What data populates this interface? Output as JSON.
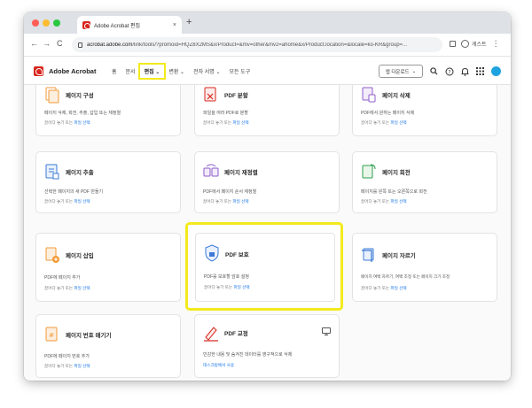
{
  "browser": {
    "tab_title": "Adobe Acrobat 편집",
    "tab_close": "×",
    "new_tab": "+",
    "back": "←",
    "forward": "→",
    "reload": "C",
    "url_host": "acrobat.adobe.com",
    "url_path": "/link/tools/?promoid=HQZ8X2MS&x/Product=&mv=other&mv2=ahome&x/Product.location=&locale=ko-KR&group=...",
    "profile_label": "게스트",
    "menu": "⋮"
  },
  "app": {
    "brand": "Adobe Acrobat",
    "nav": [
      "홈",
      "문서",
      "편집 ⌄",
      "변환 ⌄",
      "전자 서명 ⌄",
      "모든 도구"
    ],
    "install_label": "앱 다운로드",
    "install_chevron": "⌄",
    "icons": [
      "search-icon",
      "help-icon",
      "bell-icon",
      "apps-grid-icon"
    ],
    "accent": "#d7261e",
    "highlight": "#f3ea1c",
    "link_color": "#1473e6"
  },
  "cards": [
    {
      "title": "페이지 구성",
      "desc": "페이지 삭제, 회전, 추출, 삽입 또는 재정렬",
      "action_prefix": "끌어다 놓기 또는 ",
      "action_link": "파일 선택",
      "icon": "organize-pages-icon"
    },
    {
      "title": "PDF 분할",
      "desc": "파일을 여러 PDF로 분할",
      "action_prefix": "끌어다 놓기 또는 ",
      "action_link": "파일 선택",
      "icon": "split-pdf-icon"
    },
    {
      "title": "페이지 삭제",
      "desc": "PDF에서 원하는 페이지 삭제",
      "action_prefix": "끌어다 놓기 또는 ",
      "action_link": "파일 선택",
      "icon": "delete-pages-icon"
    },
    {
      "title": "페이지 추출",
      "desc": "선택한 페이지의 새 PDF 만들기",
      "action_prefix": "끌어다 놓기 또는 ",
      "action_link": "파일 선택",
      "icon": "extract-pages-icon"
    },
    {
      "title": "페이지 재정렬",
      "desc": "PDF에서 페이지 순서 재정렬",
      "action_prefix": "끌어다 놓기 또는 ",
      "action_link": "파일 선택",
      "icon": "reorder-pages-icon"
    },
    {
      "title": "페이지 회전",
      "desc": "페이지를 왼쪽 또는 오른쪽으로 회전",
      "action_prefix": "끌어다 놓기 또는 ",
      "action_link": "파일 선택",
      "icon": "rotate-pages-icon"
    },
    {
      "title": "페이지 삽입",
      "desc": "PDF에 페이지 추가",
      "action_prefix": "끌어다 놓기 또는 ",
      "action_link": "파일 선택",
      "icon": "insert-pages-icon"
    },
    {
      "title": "PDF 보호",
      "desc": "PDF를 보호할 암호 설정",
      "action_prefix": "끌어다 놓기 또는 ",
      "action_link": "파일 선택",
      "icon": "protect-pdf-icon"
    },
    {
      "title": "페이지 자르기",
      "desc": "페이지 여백 자르기, 여백 조정 또는 페이지 크기 조정",
      "action_prefix": "끌어다 놓기 또는 ",
      "action_link": "파일 선택",
      "icon": "crop-pages-icon"
    },
    {
      "title": "페이지 번호 매기기",
      "desc": "PDF에 페이지 번호 추가",
      "action_prefix": "끌어다 놓기 또는 ",
      "action_link": "파일 선택",
      "icon": "number-pages-icon"
    },
    {
      "title": "PDF 교정",
      "desc": "민감한 내용 및 숨겨진 데이터를 영구적으로 삭제",
      "action_prefix": "",
      "action_link": "데스크탑에서 사용",
      "icon": "redact-pdf-icon",
      "extra_icon": "desktop-icon"
    }
  ]
}
